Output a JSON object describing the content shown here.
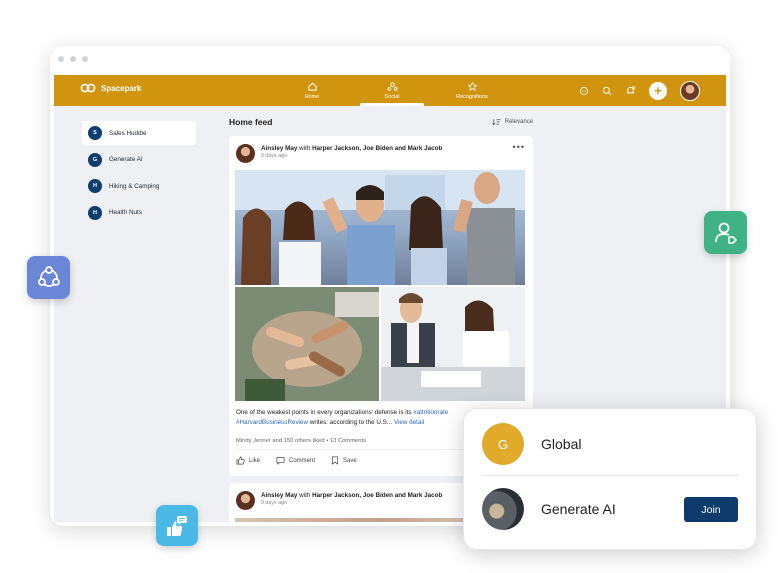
{
  "app": {
    "logo_text": "Spacepark",
    "brand_color": "#d1940f",
    "nav": [
      {
        "label": "Home",
        "icon": "home-icon"
      },
      {
        "label": "Social",
        "icon": "social-icon",
        "active": true
      },
      {
        "label": "Recognitions",
        "icon": "star-icon"
      }
    ],
    "top_icons": [
      "chat-icon",
      "search-icon",
      "notifications-icon",
      "plus-icon",
      "avatar"
    ]
  },
  "sidebar": {
    "items": [
      {
        "initial": "S",
        "label": "Sales Huddle",
        "active": true
      },
      {
        "initial": "G",
        "label": "Generate AI"
      },
      {
        "initial": "H",
        "label": "Hiking & Camping"
      },
      {
        "initial": "H",
        "label": "Health Nuts"
      }
    ]
  },
  "feed": {
    "title": "Home feed",
    "sort_label": "Relevance"
  },
  "post1": {
    "author": "Ainsley May",
    "with_word": "with",
    "tagged": "Harper Jackson, Joe Biden and Mark Jacob",
    "time": "9 days ago",
    "text_line1": "One of the weakest points in every organizations' defense is its",
    "hashtag1": "#attritionrate",
    "hashtag2": "#HarvardBusinessReview",
    "text_line2": "writes: according to the U.S...",
    "view_detail": "View detail",
    "likes_text": "Mindy Jenner and 150 others liked",
    "separator": "•",
    "comments_text": "13 Comments",
    "actions": {
      "like": "Like",
      "comment": "Comment",
      "save": "Save"
    }
  },
  "post2": {
    "author": "Ainsley May",
    "with_word": "with",
    "tagged": "Harper Jackson, Joe Biden and Mark Jacob",
    "time": "9 days ago"
  },
  "popup": {
    "items": [
      {
        "initial": "G",
        "label": "Global"
      },
      {
        "label": "Generate AI",
        "button": "Join"
      }
    ]
  },
  "colors": {
    "people_badge": "#6b86d6",
    "user_badge": "#3fb286",
    "thumb_badge": "#4ab9e6",
    "join_button": "#0e3b6c",
    "group_avatar": "#0f3d6e"
  }
}
